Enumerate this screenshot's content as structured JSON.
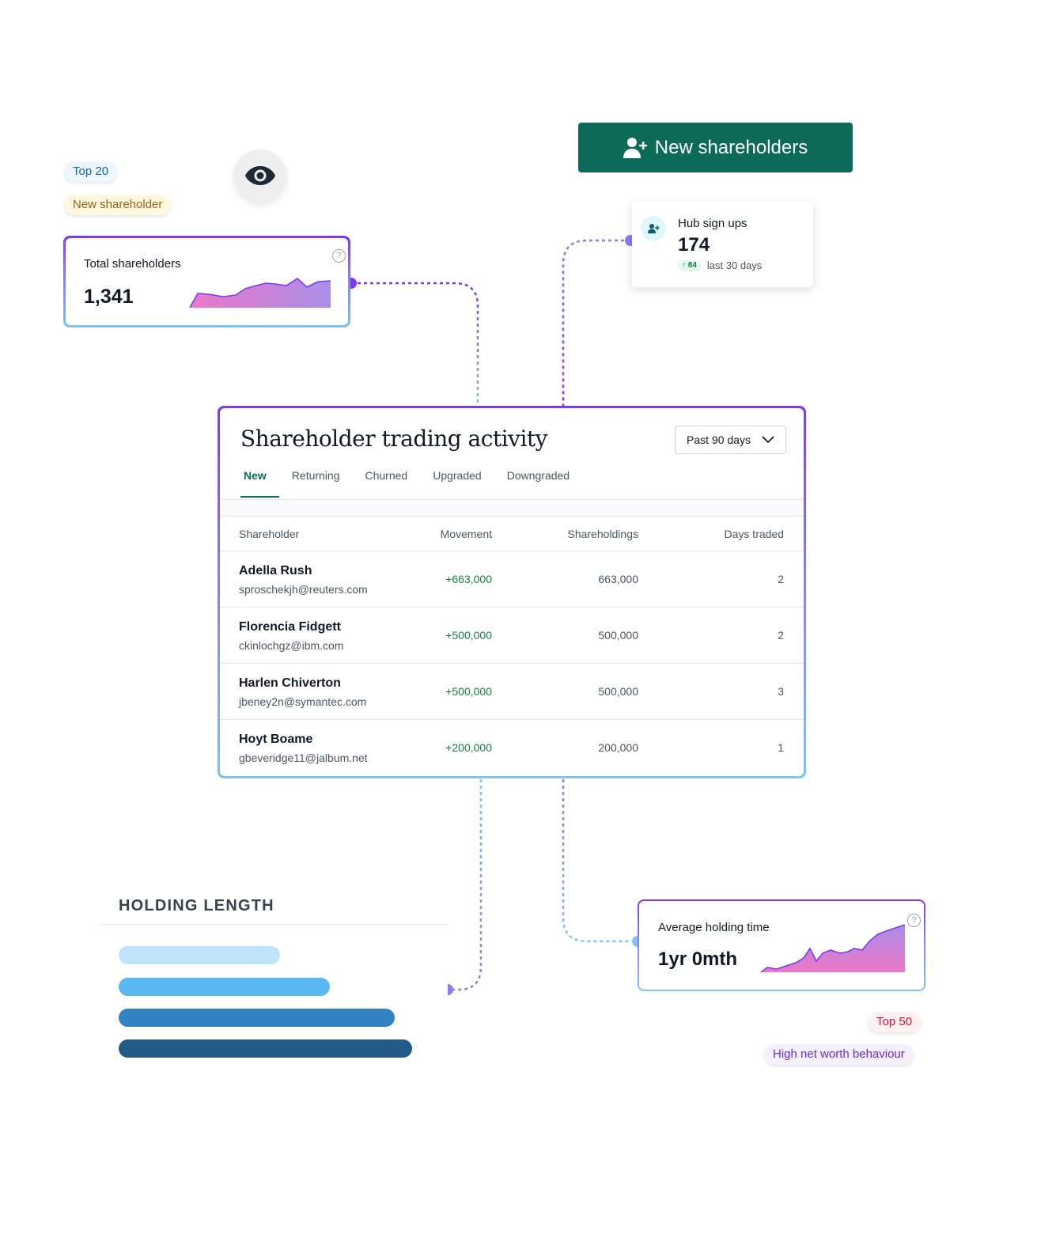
{
  "tags": {
    "top20": "Top 20",
    "new_shareholder": "New shareholder",
    "top50": "Top 50",
    "high_net_worth": "High net worth behaviour"
  },
  "icons": {
    "eye": "eye-icon",
    "add_user": "user-plus-icon",
    "help": "help-circle-icon",
    "trend_up": "arrow-up-icon",
    "chevron": "chevron-down-icon"
  },
  "colors": {
    "brand_green": "#0c6b58",
    "positive": "#15803d",
    "accent_purple": "#7c3aed",
    "accent_blue": "#7fc4f2"
  },
  "cta": {
    "label": "New shareholders"
  },
  "total_shareholders": {
    "label": "Total shareholders",
    "value": "1,341",
    "help": "?"
  },
  "hub_signups": {
    "label": "Hub sign ups",
    "value": "174",
    "trend_value": "84",
    "trend_label": "last 30 days"
  },
  "trading": {
    "title": "Shareholder trading activity",
    "period": "Past 90 days",
    "tabs": [
      "New",
      "Returning",
      "Churned",
      "Upgraded",
      "Downgraded"
    ],
    "active_tab": "New",
    "columns": [
      "Shareholder",
      "Movement",
      "Shareholdings",
      "Days traded"
    ],
    "rows": [
      {
        "name": "Adella Rush",
        "email": "sproschekjh@reuters.com",
        "movement": "+663,000",
        "holdings": "663,000",
        "days": "2"
      },
      {
        "name": "Florencia Fidgett",
        "email": "ckinlochgz@ibm.com",
        "movement": "+500,000",
        "holdings": "500,000",
        "days": "2"
      },
      {
        "name": "Harlen Chiverton",
        "email": "jbeney2n@symantec.com",
        "movement": "+500,000",
        "holdings": "500,000",
        "days": "3"
      },
      {
        "name": "Hoyt Boame",
        "email": "gbeveridge11@jalbum.net",
        "movement": "+200,000",
        "holdings": "200,000",
        "days": "1"
      }
    ]
  },
  "holding_length": {
    "title": "HOLDING LENGTH",
    "bars": [
      {
        "fraction": 0.55,
        "color": "#bfe3fa"
      },
      {
        "fraction": 0.72,
        "color": "#5ab8f0"
      },
      {
        "fraction": 0.94,
        "color": "#3282c4"
      },
      {
        "fraction": 1.0,
        "color": "#245a87"
      }
    ]
  },
  "average_holding": {
    "label": "Average holding time",
    "value": "1yr 0mth",
    "help": "?"
  }
}
